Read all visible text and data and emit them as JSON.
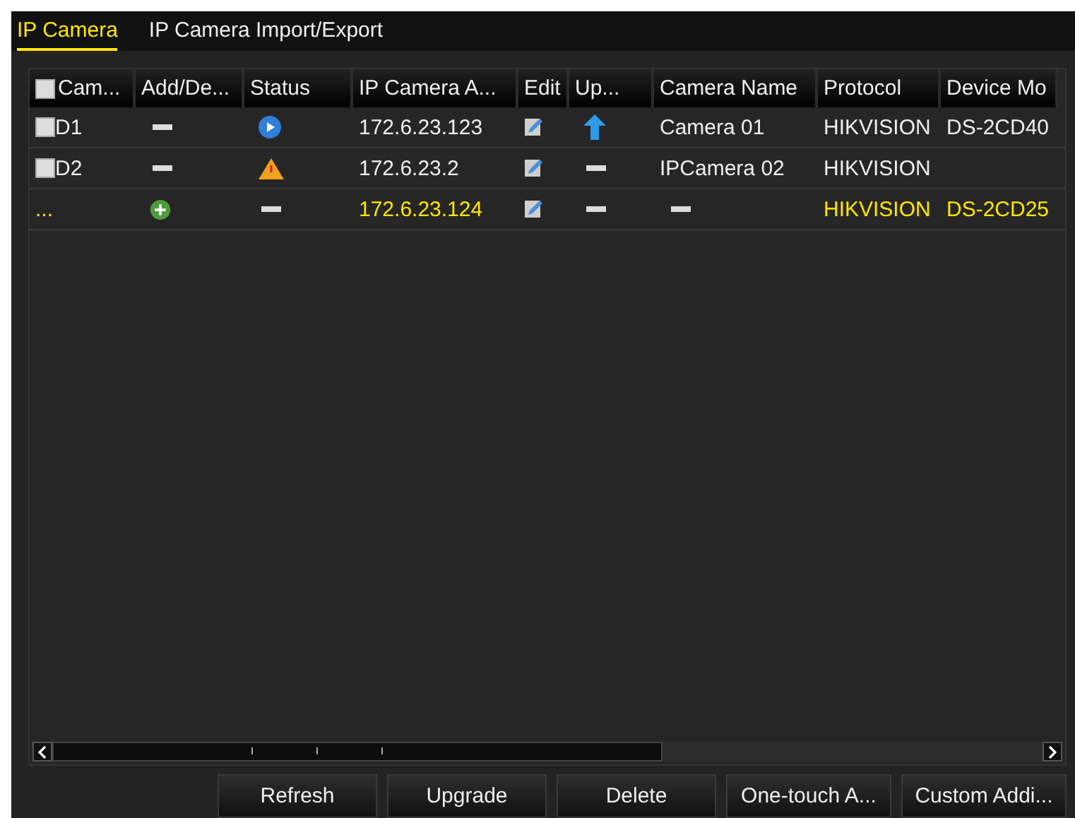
{
  "tabs": [
    {
      "label": "IP Camera",
      "selected": true
    },
    {
      "label": "IP Camera Import/Export",
      "selected": false
    }
  ],
  "table": {
    "columns": [
      {
        "kind": "checkbox",
        "label": "Cam...",
        "checked": false
      },
      {
        "kind": "text",
        "label": "Add/De..."
      },
      {
        "kind": "text",
        "label": "Status"
      },
      {
        "kind": "text",
        "label": "IP Camera A..."
      },
      {
        "kind": "text",
        "label": "Edit"
      },
      {
        "kind": "text",
        "label": "Up..."
      },
      {
        "kind": "text",
        "label": "Camera Name"
      },
      {
        "kind": "text",
        "label": "Protocol"
      },
      {
        "kind": "text",
        "label": "Device Mo"
      }
    ],
    "rows": [
      {
        "kind": "added",
        "cells": [
          {
            "kind": "checkbox",
            "checked": false,
            "text": "D1"
          },
          {
            "kind": "dash"
          },
          {
            "kind": "online"
          },
          {
            "kind": "text",
            "text": "172.6.23.123"
          },
          {
            "kind": "edit"
          },
          {
            "kind": "upgrade"
          },
          {
            "kind": "text",
            "text": "Camera 01"
          },
          {
            "kind": "text",
            "text": "HIKVISION"
          },
          {
            "kind": "text",
            "text": "DS-2CD40"
          }
        ]
      },
      {
        "kind": "added",
        "cells": [
          {
            "kind": "checkbox",
            "checked": false,
            "text": "D2"
          },
          {
            "kind": "dash"
          },
          {
            "kind": "warning"
          },
          {
            "kind": "text",
            "text": "172.6.23.2"
          },
          {
            "kind": "edit"
          },
          {
            "kind": "dash"
          },
          {
            "kind": "text",
            "text": "IPCamera 02"
          },
          {
            "kind": "text",
            "text": "HIKVISION"
          }
        ]
      },
      {
        "kind": "discovered",
        "cells": [
          {
            "kind": "text",
            "text": "..."
          },
          {
            "kind": "add"
          },
          {
            "kind": "dash"
          },
          {
            "kind": "text",
            "text": "172.6.23.124"
          },
          {
            "kind": "edit"
          },
          {
            "kind": "dash"
          },
          {
            "kind": "dash"
          },
          {
            "kind": "text",
            "text": "HIKVISION"
          },
          {
            "kind": "text",
            "text": "DS-2CD25"
          }
        ]
      }
    ]
  },
  "buttons": [
    "Refresh",
    "Upgrade",
    "Delete",
    "One-touch A...",
    "Custom Addi..."
  ]
}
